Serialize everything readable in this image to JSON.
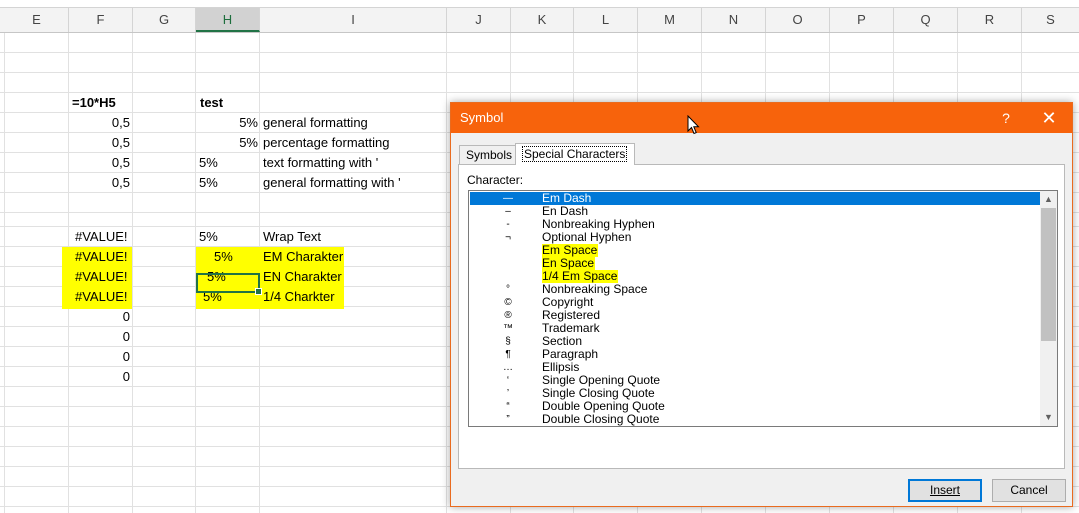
{
  "spreadsheet": {
    "columns": [
      "E",
      "F",
      "G",
      "H",
      "I",
      "J",
      "K",
      "L",
      "M",
      "N",
      "O",
      "P",
      "Q",
      "R",
      "S"
    ],
    "selected_column": "H",
    "cells": {
      "f5": "=10*H5",
      "h5": "test",
      "f6": "0,5",
      "h6": "5%",
      "i6": "general formatting",
      "f7": "0,5",
      "h7": "5%",
      "i7": "percentage formatting",
      "f8": "0,5",
      "h8": "5%",
      "i8": "text formatting with '",
      "f9": "0,5",
      "h9": "5%",
      "i9": "general formatting with '",
      "f11": "#VALUE!",
      "h11": "5%",
      "i11": "Wrap Text",
      "f12": "#VALUE!",
      "h12": "5%",
      "i12": "EM Charakter",
      "f13": "#VALUE!",
      "h13": "5%",
      "i13": "EN Charakter",
      "f14": "#VALUE!",
      "h14": "5%",
      "i14": "1/4 Charkter",
      "f15": "0",
      "f16": "0",
      "f17": "0",
      "f18": "0"
    },
    "highlight_color": "#ffff00",
    "selection_color": "#217346"
  },
  "dialog": {
    "title": "Symbol",
    "help_label": "?",
    "close_label": "✕",
    "title_color": "#f7630c",
    "tabs": [
      {
        "label": "Symbols",
        "active": false
      },
      {
        "label": "Special Characters",
        "active": true
      }
    ],
    "character_label": "Character:",
    "characters": [
      {
        "symbol": "—",
        "name": "Em Dash",
        "selected": true,
        "highlighted": false
      },
      {
        "symbol": "–",
        "name": "En Dash",
        "selected": false,
        "highlighted": false
      },
      {
        "symbol": "‑",
        "name": "Nonbreaking Hyphen",
        "selected": false,
        "highlighted": false
      },
      {
        "symbol": "¬",
        "name": "Optional Hyphen",
        "selected": false,
        "highlighted": false
      },
      {
        "symbol": "",
        "name": "Em Space",
        "selected": false,
        "highlighted": true
      },
      {
        "symbol": "",
        "name": "En Space",
        "selected": false,
        "highlighted": true
      },
      {
        "symbol": "",
        "name": "1/4 Em Space",
        "selected": false,
        "highlighted": true
      },
      {
        "symbol": "°",
        "name": "Nonbreaking Space",
        "selected": false,
        "highlighted": false
      },
      {
        "symbol": "©",
        "name": "Copyright",
        "selected": false,
        "highlighted": false
      },
      {
        "symbol": "®",
        "name": "Registered",
        "selected": false,
        "highlighted": false
      },
      {
        "symbol": "™",
        "name": "Trademark",
        "selected": false,
        "highlighted": false
      },
      {
        "symbol": "§",
        "name": "Section",
        "selected": false,
        "highlighted": false
      },
      {
        "symbol": "¶",
        "name": "Paragraph",
        "selected": false,
        "highlighted": false
      },
      {
        "symbol": "…",
        "name": "Ellipsis",
        "selected": false,
        "highlighted": false
      },
      {
        "symbol": "‘",
        "name": "Single Opening Quote",
        "selected": false,
        "highlighted": false
      },
      {
        "symbol": "’",
        "name": "Single Closing Quote",
        "selected": false,
        "highlighted": false
      },
      {
        "symbol": "“",
        "name": "Double Opening Quote",
        "selected": false,
        "highlighted": false
      },
      {
        "symbol": "”",
        "name": "Double Closing Quote",
        "selected": false,
        "highlighted": false
      }
    ],
    "scroll_up_icon": "▲",
    "scroll_down_icon": "▼",
    "insert_label": "Insert",
    "cancel_label": "Cancel"
  }
}
